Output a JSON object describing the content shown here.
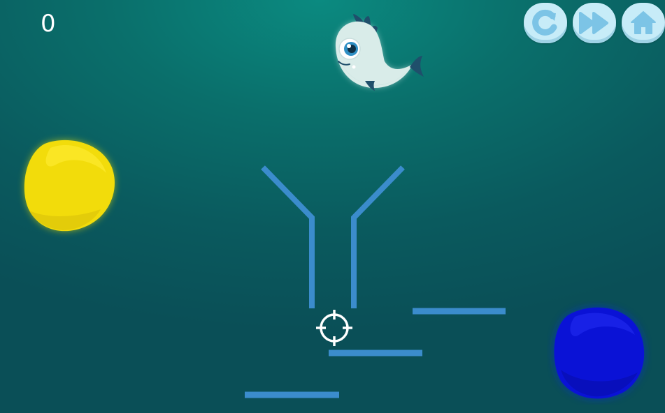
{
  "hud": {
    "score": "0"
  },
  "toolbar": {
    "buttons": [
      {
        "icon": "restart-icon"
      },
      {
        "icon": "skip-icon"
      },
      {
        "icon": "home-icon"
      }
    ]
  },
  "colors": {
    "line": "#3b8ccc",
    "button_bg": "#c7ecf8",
    "button_icon": "#7cc4e6",
    "yellow_blob": "#f2dc0b",
    "blue_blob": "#0a12d6",
    "fish_body": "#d9ece9",
    "fish_fin": "#1f4f6b"
  },
  "game": {
    "character": "fish",
    "targets": [
      "yellow-blob",
      "blue-blob"
    ],
    "pointer": "crosshair-icon"
  }
}
